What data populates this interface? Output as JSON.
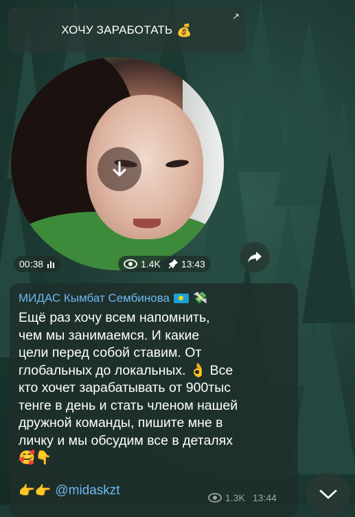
{
  "top_button": {
    "label": "ХОЧУ ЗАРАБОТАТЬ",
    "emoji": "💰",
    "corner_icon": "↗"
  },
  "video": {
    "duration": "00:38",
    "views": "1.4K",
    "time": "13:43"
  },
  "message": {
    "sender": "МИДАС Кымбат Сембинова",
    "sender_emoji": "💸",
    "text": "Ещё раз хочу всем напомнить,\nчем мы занимаемся. И какие\nцели перед собой ставим. От\nглобальных до локальных. 👌 Все\nкто хочет зарабатывать от 900тыс\nтенге в день и стать членом нашей\nдружной команды, пишите мне в\nличку и мы обсудим все в деталях\n🥰👇",
    "link_prefix": "👉👉",
    "link": "@midaskzt",
    "views": "1.3K",
    "time": "13:44"
  },
  "colors": {
    "accent": "#6fb8f0",
    "bubble": "#1e2e2a"
  }
}
